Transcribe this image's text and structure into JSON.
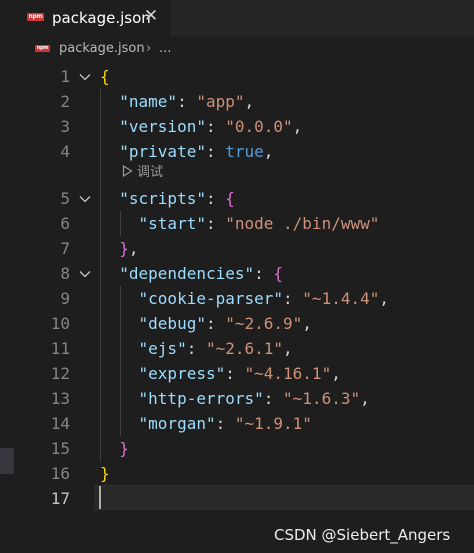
{
  "tab": {
    "badge": "npm",
    "title": "package.json",
    "close_glyph": "✕"
  },
  "breadcrumb": {
    "badge": "npm",
    "file": "package.json",
    "separator": "›",
    "more": "..."
  },
  "editor": {
    "codelens_label": "调试",
    "active_line": "17",
    "lines": [
      {
        "number": "1",
        "fold": true,
        "tokens": [
          [
            "{",
            "brace-1"
          ]
        ]
      },
      {
        "number": "2",
        "fold": false,
        "tokens": [
          [
            "  ",
            "punct"
          ],
          [
            "\"name\"",
            "key"
          ],
          [
            ": ",
            "punct"
          ],
          [
            "\"app\"",
            "str"
          ],
          [
            ",",
            "punct"
          ]
        ]
      },
      {
        "number": "3",
        "fold": false,
        "tokens": [
          [
            "  ",
            "punct"
          ],
          [
            "\"version\"",
            "key"
          ],
          [
            ": ",
            "punct"
          ],
          [
            "\"0.0.0\"",
            "str"
          ],
          [
            ",",
            "punct"
          ]
        ]
      },
      {
        "number": "4",
        "fold": false,
        "tokens": [
          [
            "  ",
            "punct"
          ],
          [
            "\"private\"",
            "key"
          ],
          [
            ": ",
            "punct"
          ],
          [
            "true",
            "kw"
          ],
          [
            ",",
            "punct"
          ]
        ]
      },
      {
        "number": "5",
        "fold": true,
        "tokens": [
          [
            "  ",
            "punct"
          ],
          [
            "\"scripts\"",
            "key"
          ],
          [
            ": ",
            "punct"
          ],
          [
            "{",
            "brace-2"
          ]
        ]
      },
      {
        "number": "6",
        "fold": false,
        "tokens": [
          [
            "    ",
            "punct"
          ],
          [
            "\"start\"",
            "key"
          ],
          [
            ": ",
            "punct"
          ],
          [
            "\"node ./bin/www\"",
            "str"
          ]
        ]
      },
      {
        "number": "7",
        "fold": false,
        "tokens": [
          [
            "  ",
            "punct"
          ],
          [
            "}",
            "brace-2"
          ],
          [
            ",",
            "punct"
          ]
        ]
      },
      {
        "number": "8",
        "fold": true,
        "tokens": [
          [
            "  ",
            "punct"
          ],
          [
            "\"dependencies\"",
            "key"
          ],
          [
            ": ",
            "punct"
          ],
          [
            "{",
            "brace-2"
          ]
        ]
      },
      {
        "number": "9",
        "fold": false,
        "tokens": [
          [
            "    ",
            "punct"
          ],
          [
            "\"cookie-parser\"",
            "key"
          ],
          [
            ": ",
            "punct"
          ],
          [
            "\"~1.4.4\"",
            "str"
          ],
          [
            ",",
            "punct"
          ]
        ]
      },
      {
        "number": "10",
        "fold": false,
        "tokens": [
          [
            "    ",
            "punct"
          ],
          [
            "\"debug\"",
            "key"
          ],
          [
            ": ",
            "punct"
          ],
          [
            "\"~2.6.9\"",
            "str"
          ],
          [
            ",",
            "punct"
          ]
        ]
      },
      {
        "number": "11",
        "fold": false,
        "tokens": [
          [
            "    ",
            "punct"
          ],
          [
            "\"ejs\"",
            "key"
          ],
          [
            ": ",
            "punct"
          ],
          [
            "\"~2.6.1\"",
            "str"
          ],
          [
            ",",
            "punct"
          ]
        ]
      },
      {
        "number": "12",
        "fold": false,
        "tokens": [
          [
            "    ",
            "punct"
          ],
          [
            "\"express\"",
            "key"
          ],
          [
            ": ",
            "punct"
          ],
          [
            "\"~4.16.1\"",
            "str"
          ],
          [
            ",",
            "punct"
          ]
        ]
      },
      {
        "number": "13",
        "fold": false,
        "tokens": [
          [
            "    ",
            "punct"
          ],
          [
            "\"http-errors\"",
            "key"
          ],
          [
            ": ",
            "punct"
          ],
          [
            "\"~1.6.3\"",
            "str"
          ],
          [
            ",",
            "punct"
          ]
        ]
      },
      {
        "number": "14",
        "fold": false,
        "tokens": [
          [
            "    ",
            "punct"
          ],
          [
            "\"morgan\"",
            "key"
          ],
          [
            ": ",
            "punct"
          ],
          [
            "\"~1.9.1\"",
            "str"
          ]
        ]
      },
      {
        "number": "15",
        "fold": false,
        "tokens": [
          [
            "  ",
            "punct"
          ],
          [
            "}",
            "brace-2"
          ]
        ]
      },
      {
        "number": "16",
        "fold": false,
        "tokens": [
          [
            "}",
            "brace-1"
          ]
        ]
      },
      {
        "number": "17",
        "fold": false,
        "tokens": []
      }
    ]
  },
  "watermark": "CSDN @Siebert_Angers",
  "colors": {
    "background": "#1e1e1e",
    "tabbar": "#252526",
    "key": "#9cdcfe",
    "string": "#ce9178",
    "keyword": "#569cd6",
    "brace_level_1": "#ffd700",
    "brace_level_2": "#da70d6",
    "npm_badge": "#cb3837"
  }
}
